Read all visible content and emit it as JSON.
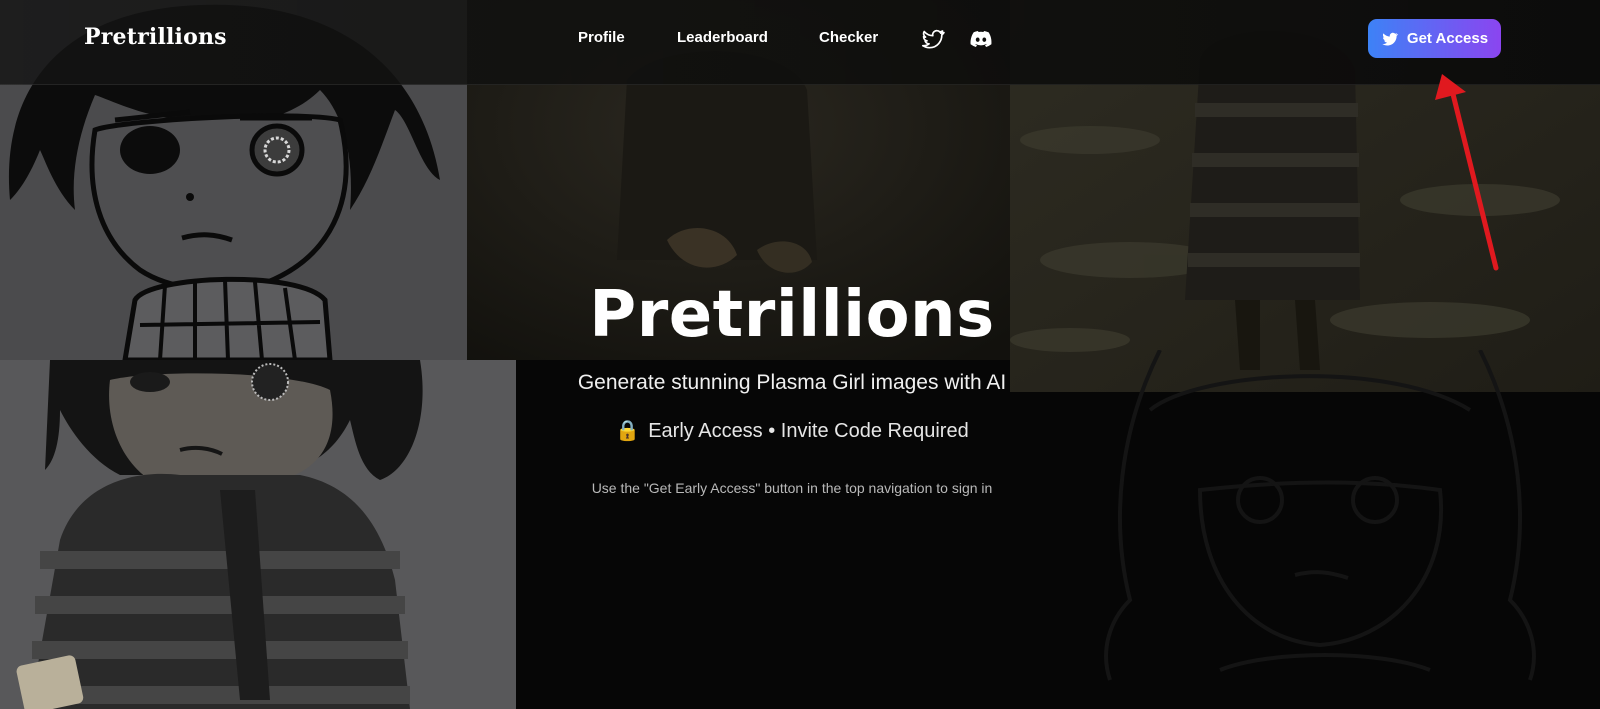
{
  "header": {
    "brand": "Pretrillions",
    "nav": [
      {
        "label": "Profile"
      },
      {
        "label": "Leaderboard"
      },
      {
        "label": "Checker"
      }
    ],
    "social_icons": [
      "twitter-icon",
      "discord-icon"
    ],
    "cta": {
      "label": "Get Access",
      "icon": "twitter-icon"
    }
  },
  "hero": {
    "title": "Pretrillions",
    "subtitle": "Generate stunning Plasma Girl images with AI",
    "access_icon": "lock-icon",
    "access_text": "Early Access • Invite Code Required",
    "hint": "Use the \"Get Early Access\" button in the top navigation to sign in"
  },
  "colors": {
    "cta_start": "#3d82f6",
    "cta_end": "#8b45f0",
    "annotation": "#e0191f",
    "background": "#060606"
  }
}
